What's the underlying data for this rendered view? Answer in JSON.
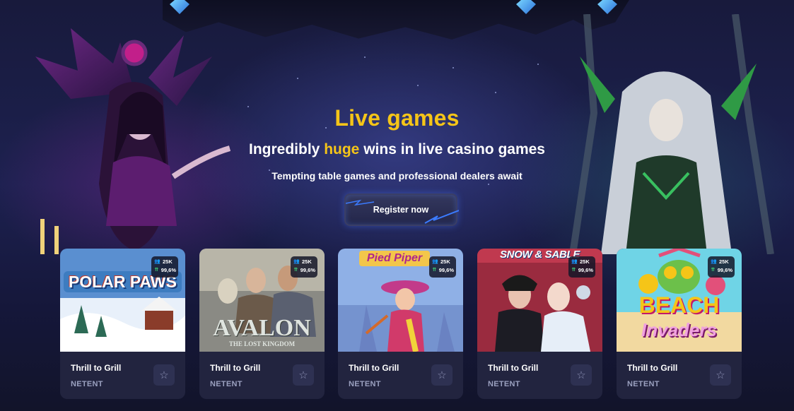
{
  "hero": {
    "title": "Live games",
    "subtitle_pre": "Ingredibly ",
    "subtitle_highlight": "huge",
    "subtitle_post": " wins in live casino games",
    "tagline": "Tempting table games and professional dealers await",
    "register_label": "Register now"
  },
  "colors": {
    "accent": "#f5c518",
    "card_bg": "#22243f",
    "stat_icon": "#3fd17a"
  },
  "cards": [
    {
      "art_title": "POLAR PAWS",
      "title": "Thrill to Grill",
      "provider": "NETENT",
      "players": "25K",
      "rtp": "99,6%"
    },
    {
      "art_title": "AVALON",
      "art_subtitle": "THE LOST KINGDOM",
      "title": "Thrill to Grill",
      "provider": "NETENT",
      "players": "25K",
      "rtp": "99,6%"
    },
    {
      "art_title": "Pied Piper",
      "title": "Thrill to Grill",
      "provider": "NETENT",
      "players": "25K",
      "rtp": "99,6%"
    },
    {
      "art_title": "SNOW & SABLE",
      "title": "Thrill to Grill",
      "provider": "NETENT",
      "players": "25K",
      "rtp": "99,6%"
    },
    {
      "art_title": "BEACH",
      "art_subtitle": "Invaders",
      "title": "Thrill to Grill",
      "provider": "NETENT",
      "players": "25K",
      "rtp": "99,6%"
    }
  ],
  "icons": {
    "players": "users-icon",
    "rtp": "rtp-icon",
    "favorite": "star-icon"
  }
}
